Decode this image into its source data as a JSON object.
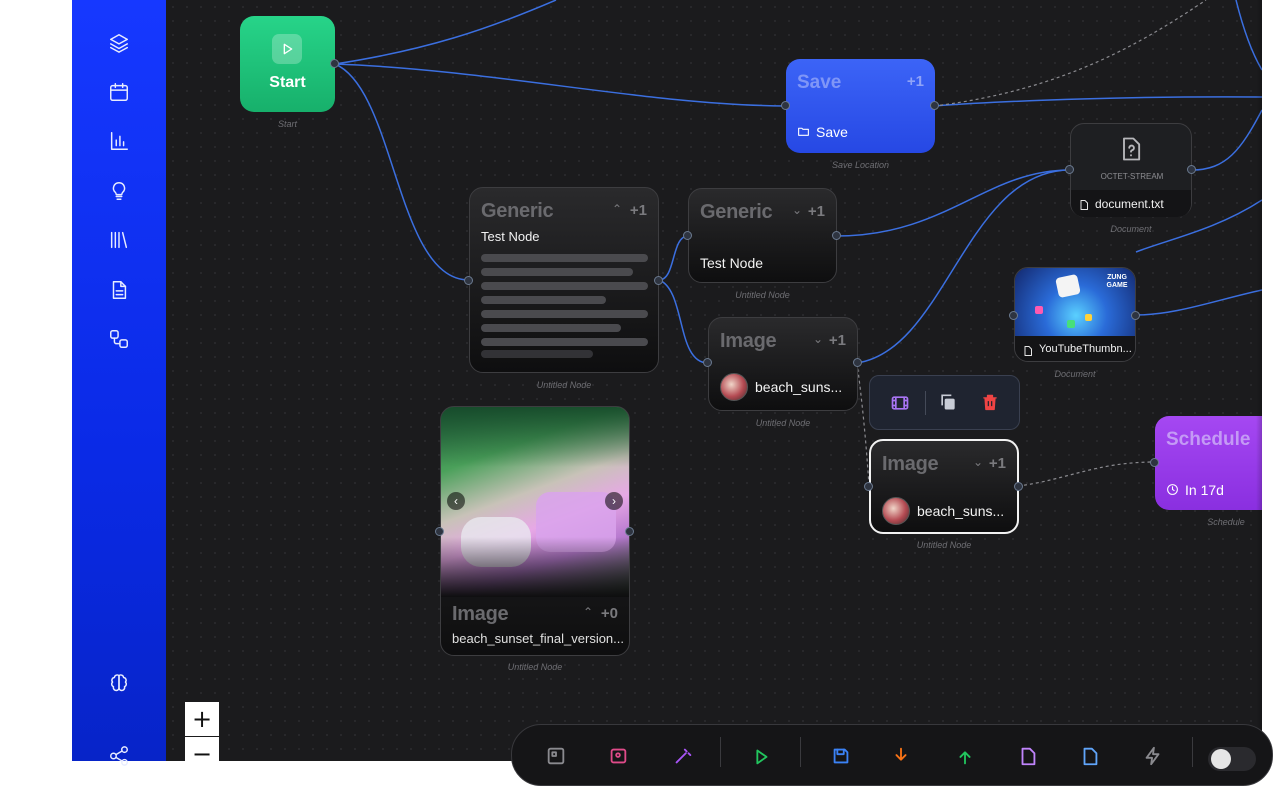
{
  "sidebar": {
    "items": [
      {
        "name": "layers-icon"
      },
      {
        "name": "calendar-icon"
      },
      {
        "name": "chart-icon"
      },
      {
        "name": "lightbulb-icon"
      },
      {
        "name": "library-icon"
      },
      {
        "name": "document-icon"
      },
      {
        "name": "workflow-icon"
      },
      {
        "name": "brain-icon"
      },
      {
        "name": "share-icon"
      }
    ]
  },
  "nodes": {
    "start": {
      "label": "Start",
      "caption": "Start"
    },
    "save": {
      "title": "Save",
      "count": "+1",
      "action": "Save",
      "caption": "Save Location"
    },
    "generic1": {
      "title": "Generic",
      "count": "+1",
      "subtitle": "Test Node",
      "caption": "Untitled Node"
    },
    "generic2": {
      "title": "Generic",
      "count": "+1",
      "subtitle": "Test Node",
      "caption": "Untitled Node"
    },
    "image1": {
      "title": "Image",
      "count": "+1",
      "filename": "beach_suns...",
      "caption": "Untitled Node"
    },
    "image2": {
      "title": "Image",
      "count": "+1",
      "filename": "beach_suns...",
      "caption": "Untitled Node"
    },
    "image_preview": {
      "title": "Image",
      "count": "+0",
      "filename": "beach_sunset_final_version...",
      "caption": "Untitled Node"
    },
    "doc1": {
      "type_label": "OCTET-STREAM",
      "filename": "document.txt",
      "caption": "Document"
    },
    "doc2": {
      "filename": "YouTubeThumbn...",
      "caption": "Document",
      "thumb_text": "ZUNG GAME"
    },
    "schedule": {
      "title": "Schedule",
      "time": "In 17d",
      "caption": "Schedule"
    }
  },
  "zoom": {
    "in_label": "+",
    "out_label": "−"
  },
  "colors": {
    "sidebar": "#1638ff",
    "canvas": "#1b1b1d",
    "wire": "#3b6fe0",
    "start": "#1ec479",
    "save": "#2f55f0",
    "schedule": "#9b3df0"
  }
}
